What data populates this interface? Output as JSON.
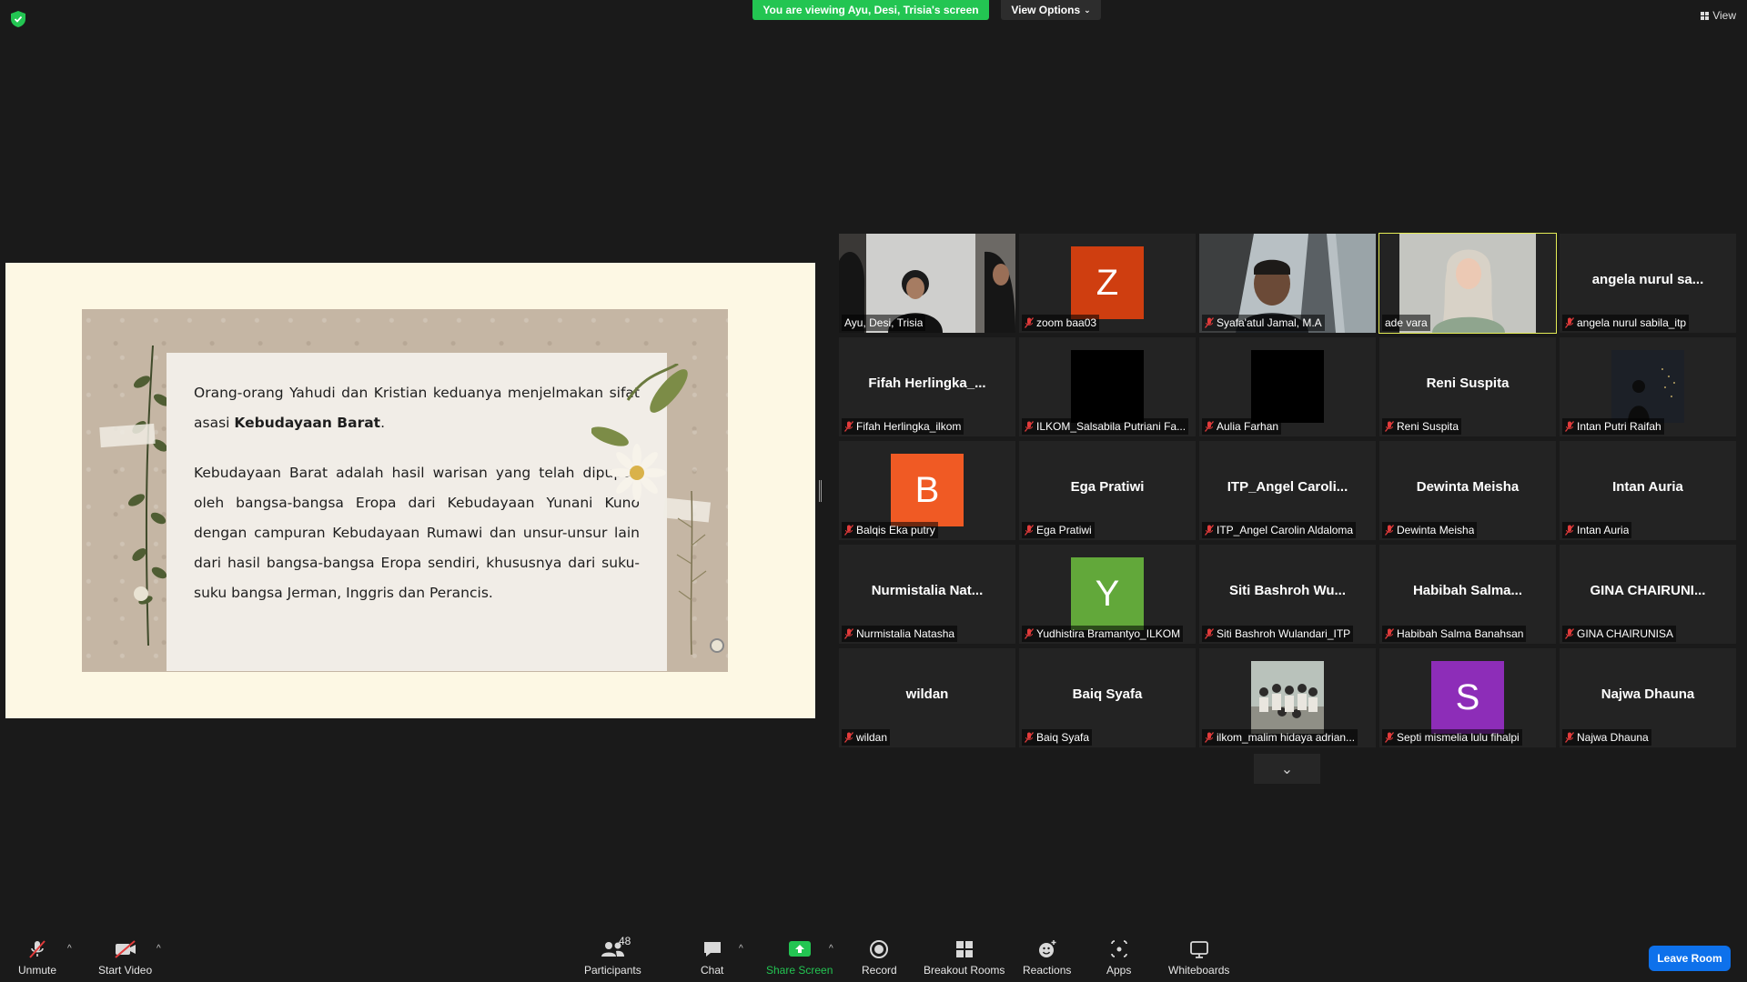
{
  "top_bar": {
    "banner": "You are viewing Ayu, Desi, Trisia's screen",
    "view_options": "View Options",
    "view_label": "View"
  },
  "slide": {
    "paragraph1_a": "Orang-orang Yahudi dan Kristian keduanya menjelmakan sifat asasi ",
    "paragraph1_bold": "Kebudayaan Barat",
    "paragraph1_end": ".",
    "paragraph2": "Kebudayaan Barat adalah hasil warisan yang telah dipupuk oleh bangsa-bangsa Eropa dari Kebudayaan Yunani Kuno dengan campuran Kebudayaan Rumawi dan unsur-unsur lain dari hasil bangsa-bangsa Eropa sendiri, khususnya dari suku-suku bangsa Jerman, Inggris dan Perancis."
  },
  "participants": [
    {
      "label": "Ayu, Desi, Trisia",
      "kind": "video",
      "muted": false
    },
    {
      "label": "zoom baa03",
      "kind": "avatar",
      "initial": "Z",
      "color": "#cf3e10",
      "muted": true
    },
    {
      "label": "Syafa'atul Jamal, M.A",
      "kind": "video",
      "muted": true
    },
    {
      "label": "ade vara",
      "kind": "video",
      "muted": false,
      "active": true
    },
    {
      "label": "angela nurul sabila_itp",
      "kind": "name",
      "big": "angela nurul sa...",
      "muted": true
    },
    {
      "label": "Fifah Herlingka_ilkom",
      "kind": "name",
      "big": "Fifah  Herlingka_...",
      "muted": true
    },
    {
      "label": "ILKOM_Salsabila Putriani Fa...",
      "kind": "black",
      "muted": true
    },
    {
      "label": "Aulia Farhan",
      "kind": "black",
      "muted": true
    },
    {
      "label": "Reni Suspita",
      "kind": "name",
      "big": "Reni Suspita",
      "muted": true
    },
    {
      "label": "Intan Putri Raifah",
      "kind": "photo",
      "muted": true
    },
    {
      "label": "Balqis Eka putry",
      "kind": "avatar",
      "initial": "B",
      "color": "#f05a24",
      "muted": true
    },
    {
      "label": "Ega Pratiwi",
      "kind": "name",
      "big": "Ega Pratiwi",
      "muted": true
    },
    {
      "label": "ITP_Angel Carolin Aldaloma",
      "kind": "name",
      "big": "ITP_Angel  Caroli...",
      "muted": true
    },
    {
      "label": "Dewinta Meisha",
      "kind": "name",
      "big": "Dewinta Meisha",
      "muted": true
    },
    {
      "label": "Intan Auria",
      "kind": "name",
      "big": "Intan Auria",
      "muted": true
    },
    {
      "label": "Nurmistalia Natasha",
      "kind": "name",
      "big": "Nurmistalia  Nat...",
      "muted": true
    },
    {
      "label": "Yudhistira Bramantyo_ILKOM",
      "kind": "avatar",
      "initial": "Y",
      "color": "#62a83a",
      "muted": true
    },
    {
      "label": "Siti Bashroh Wulandari_ITP",
      "kind": "name",
      "big": "Siti  Bashroh  Wu...",
      "muted": true
    },
    {
      "label": "Habibah Salma Banahsan",
      "kind": "name",
      "big": "Habibah  Salma...",
      "muted": true
    },
    {
      "label": "GINA CHAIRUNISA",
      "kind": "name",
      "big": "GINA  CHAIRUNI...",
      "muted": true
    },
    {
      "label": "wildan",
      "kind": "name",
      "big": "wildan",
      "muted": true
    },
    {
      "label": "Baiq Syafa",
      "kind": "name",
      "big": "Baiq Syafa",
      "muted": true
    },
    {
      "label": "ilkom_malim hidaya adrian...",
      "kind": "group",
      "muted": true
    },
    {
      "label": "Septi mismelia lulu fihalpi",
      "kind": "avatar",
      "initial": "S",
      "color": "#8d2db8",
      "muted": true
    },
    {
      "label": "Najwa Dhauna",
      "kind": "name",
      "big": "Najwa Dhauna",
      "muted": true
    }
  ],
  "toolbar": {
    "unmute": "Unmute",
    "start_video": "Start Video",
    "participants": "Participants",
    "participants_count": "48",
    "chat": "Chat",
    "share_screen": "Share Screen",
    "record": "Record",
    "breakout_rooms": "Breakout Rooms",
    "reactions": "Reactions",
    "apps": "Apps",
    "whiteboards": "Whiteboards",
    "leave_room": "Leave Room"
  },
  "colors": {
    "share_green": "#23c552",
    "leave_blue": "#0e71eb",
    "active_speaker": "#e4ec55"
  }
}
